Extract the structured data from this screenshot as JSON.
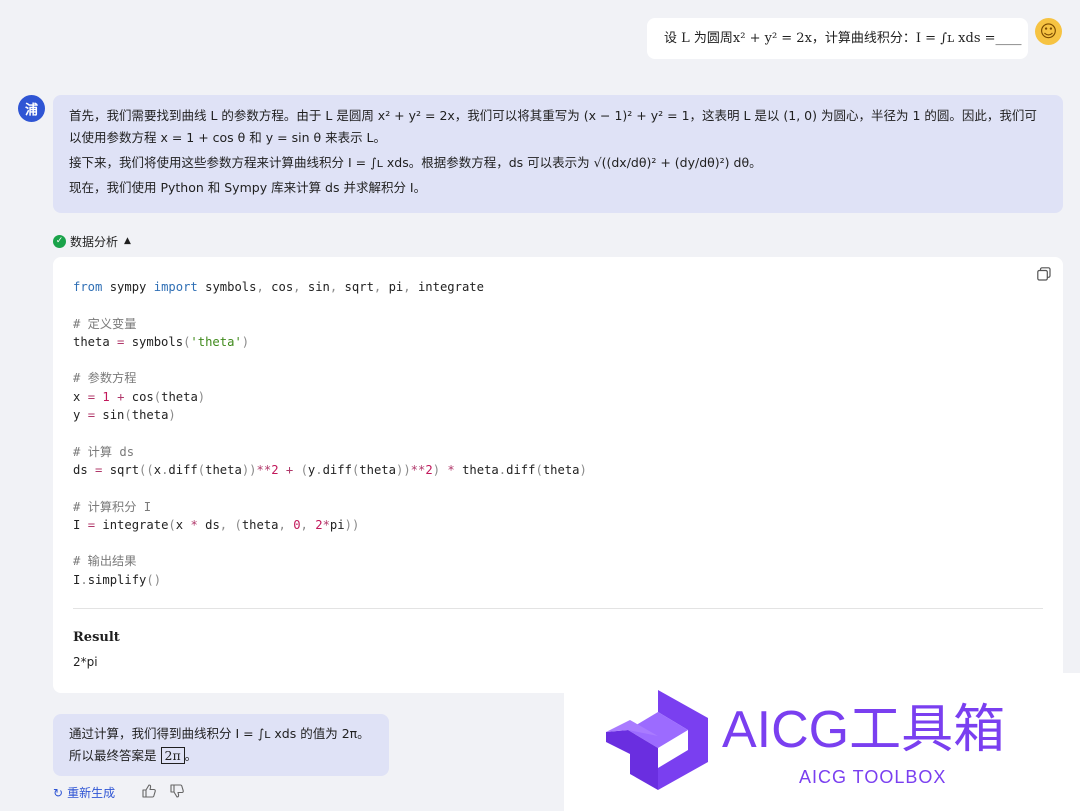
{
  "user_message": {
    "text": "设 L 为圆周x² + y² = 2x，计算曲线积分：I = ∫ʟ xds =____",
    "avatar_icon": "smiley-face-icon"
  },
  "assistant": {
    "avatar_char": "浦",
    "intro_p1": "首先，我们需要找到曲线 L 的参数方程。由于 L 是圆周 x² + y² = 2x，我们可以将其重写为 (x − 1)² + y² = 1，这表明 L 是以 (1, 0) 为圆心，半径为 1 的圆。因此，我们可以使用参数方程 x = 1 + cos θ 和 y = sin θ 来表示 L。",
    "intro_p2": "接下来，我们将使用这些参数方程来计算曲线积分 I = ∫ʟ xds。根据参数方程，ds 可以表示为 √((dx/dθ)² + (dy/dθ)²) dθ。",
    "intro_p3": "现在，我们使用 Python 和 Sympy 库来计算 ds 并求解积分 I。",
    "analysis_label": "数据分析",
    "result_label": "Result",
    "result_value": "2*pi",
    "conclusion_line1": "通过计算，我们得到曲线积分 I = ∫ʟ xds 的值为 2π。",
    "conclusion_line2_prefix": "所以最终答案是",
    "conclusion_boxed": "2π",
    "conclusion_line2_suffix": "。",
    "regenerate_label": "重新生成"
  },
  "code_lines": [
    "from sympy import symbols, cos, sin, sqrt, pi, integrate",
    "",
    "# 定义变量",
    "theta = symbols('theta')",
    "",
    "# 参数方程",
    "x = 1 + cos(theta)",
    "y = sin(theta)",
    "",
    "# 计算 ds",
    "ds = sqrt((x.diff(theta))**2 + (y.diff(theta))**2) * theta.diff(theta)",
    "",
    "# 计算积分 I",
    "I = integrate(x * ds, (theta, 0, 2*pi))",
    "",
    "# 输出结果",
    "I.simplify()"
  ],
  "watermark": {
    "title": "AICG工具箱",
    "subtitle": "AICG TOOLBOX"
  },
  "colors": {
    "accent": "#2f55d4",
    "bubble": "#dfe2f6",
    "watermark": "#7a3ff0",
    "success": "#1aa34a"
  }
}
